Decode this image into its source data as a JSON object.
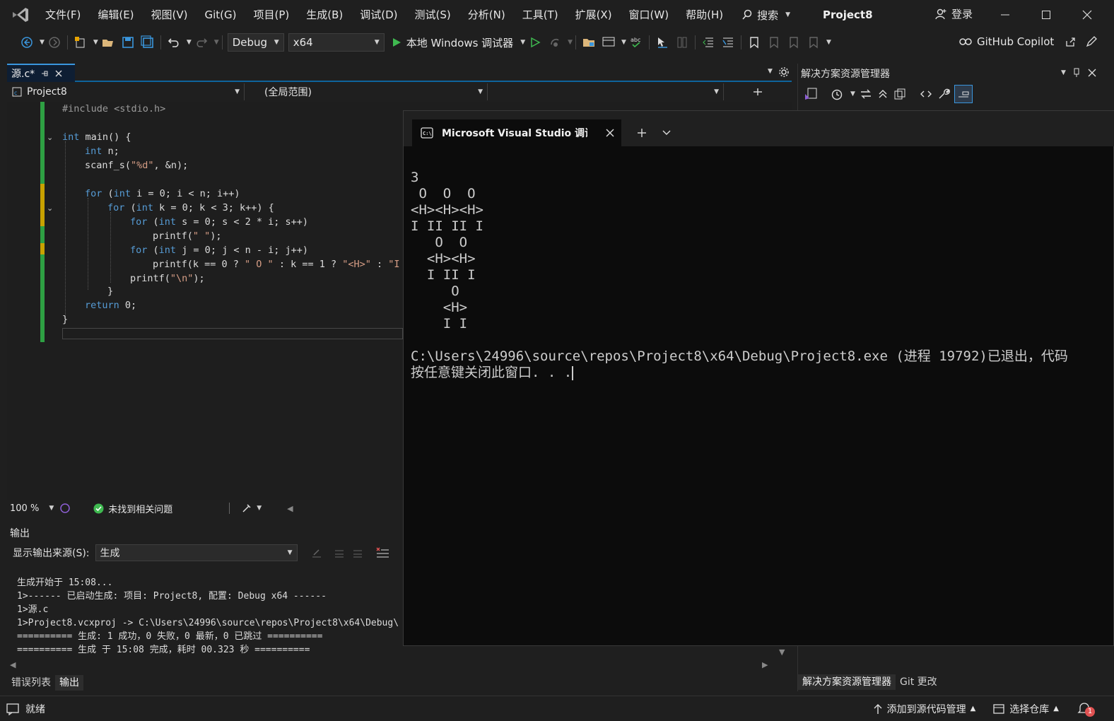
{
  "menubar": {
    "items": [
      "文件(F)",
      "编辑(E)",
      "视图(V)",
      "Git(G)",
      "项目(P)",
      "生成(B)",
      "调试(D)",
      "测试(S)",
      "分析(N)",
      "工具(T)",
      "扩展(X)",
      "窗口(W)",
      "帮助(H)"
    ],
    "search_label": "搜索",
    "project_title": "Project8",
    "login_label": "登录"
  },
  "toolbar": {
    "config": "Debug",
    "platform": "x64",
    "run_label": "本地 Windows 调试器",
    "copilot_label": "GitHub Copilot"
  },
  "editor": {
    "tab_label": "源.c*",
    "nav_project": "Project8",
    "nav_scope": "(全局范围)",
    "zoom": "100 %",
    "issues_label": "未找到相关问题"
  },
  "code": {
    "include_line": "#include <stdio.h>",
    "main_kw": "int",
    "main_rest": " main() {",
    "decl_kw": "int",
    "decl_rest": " n;",
    "scanf_pre": "scanf_s(",
    "scanf_str": "\"%d\"",
    "scanf_post": ", &n);",
    "for1_kw": "for",
    "for1_a": " (",
    "for1_int": "int",
    "for1_rest": " i = 0; i < n; i++)",
    "for2_kw": "for",
    "for2_a": " (",
    "for2_int": "int",
    "for2_rest": " k = 0; k < 3; k++) {",
    "for3_kw": "for",
    "for3_a": " (",
    "for3_int": "int",
    "for3_rest": " s = 0; s < 2 * i; s++)",
    "printf1_pre": "printf(",
    "printf1_str": "\" \"",
    "printf1_post": ");",
    "for4_kw": "for",
    "for4_a": " (",
    "for4_int": "int",
    "for4_rest": " j = 0; j < n - i; j++)",
    "printf2_pre": "printf(k == 0 ? ",
    "printf2_s1": "\" O \"",
    "printf2_mid": " : k == 1 ? ",
    "printf2_s2": "\"<H>\"",
    "printf2_mid2": " : ",
    "printf2_s3": "\"I I",
    "printf3_pre": "printf(",
    "printf3_str": "\"\\n\"",
    "printf3_post": ");",
    "close_inner": "}",
    "return_kw": "return",
    "return_rest": " 0;",
    "close_main": "}"
  },
  "output": {
    "title": "输出",
    "source_label": "显示输出来源(S):",
    "source_value": "生成",
    "lines": [
      "生成开始于 15:08...",
      "1>------ 已启动生成: 项目: Project8, 配置: Debug x64 ------",
      "1>源.c",
      "1>Project8.vcxproj -> C:\\Users\\24996\\source\\repos\\Project8\\x64\\Debug\\",
      "========== 生成: 1 成功，0 失败，0 最新，0 已跳过 ==========",
      "========== 生成 于 15:08 完成，耗时 00.323 秒 =========="
    ],
    "tab_errors": "错误列表",
    "tab_output": "输出"
  },
  "solution_explorer": {
    "title": "解决方案资源管理器",
    "tab_solution": "解决方案资源管理器",
    "tab_git": "Git 更改"
  },
  "console": {
    "tab_title": "Microsoft Visual Studio 调试控",
    "lines": [
      "3",
      " O  O  O",
      "<H><H><H>",
      "I II II I",
      "   O  O",
      "  <H><H>",
      "  I II I",
      "     O",
      "    <H>",
      "    I I",
      "",
      "C:\\Users\\24996\\source\\repos\\Project8\\x64\\Debug\\Project8.exe (进程 19792)已退出，代码",
      "按任意键关闭此窗口. . ."
    ]
  },
  "statusbar": {
    "ready": "就绪",
    "add_source": "添加到源代码管理",
    "select_repo": "选择仓库",
    "notification_count": "1"
  },
  "colors": {
    "accent": "#0e639c",
    "change_bar": "#2ea043",
    "keyword": "#569cd6",
    "string": "#d69d85",
    "console_bg": "#0c0c0c"
  }
}
